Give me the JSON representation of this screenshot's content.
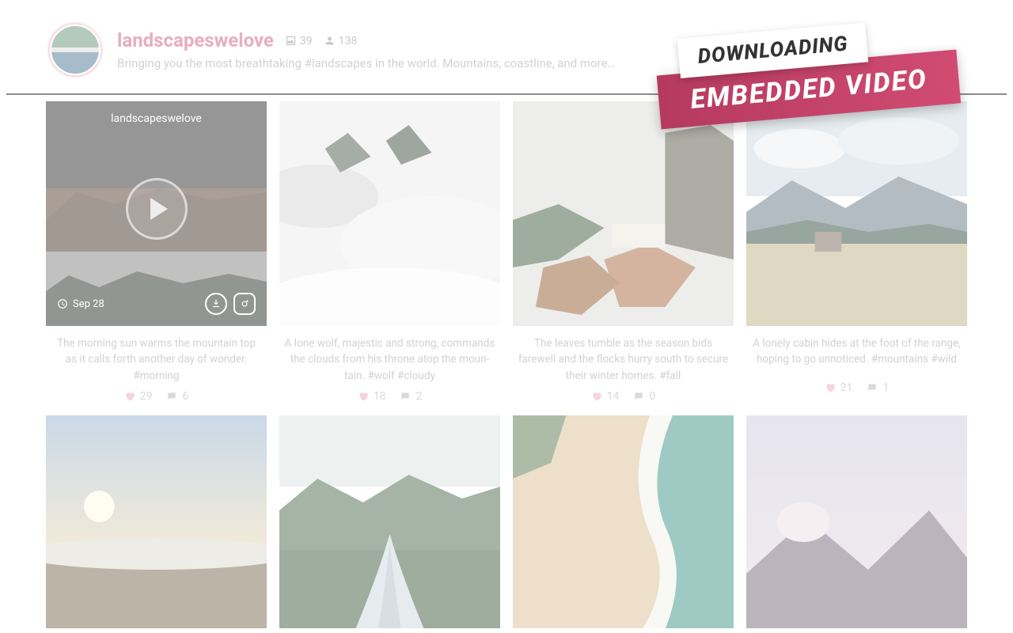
{
  "profile": {
    "username": "landscapeswelove",
    "photo_count": "39",
    "follower_count": "138",
    "bio": "Bringing you the most breathtaking #landscapes in the world. Mountains, coastline, and more…"
  },
  "banner": {
    "top": "DOWNLOADING",
    "bottom": "EMBEDDED VIDEO"
  },
  "posts": [
    {
      "caption": "The morning sun warms the mountain top as it calls forth another day of wonder. #morn­ing",
      "likes": "29",
      "comments": "6",
      "date": "Sep 28",
      "overlay_username": "landscapeswelove",
      "is_video": true
    },
    {
      "caption": "A lone wolf, majestic and strong, commands the clouds from his throne atop the moun­tain. #wolf #cloudy",
      "likes": "18",
      "comments": "2"
    },
    {
      "caption": "The leaves tumble as the season bids farewell and the flocks hurry south to secure their winter homes. #fall",
      "likes": "14",
      "comments": "0"
    },
    {
      "caption": "A lonely cabin hides at the foot of the range, hoping to go unnoticed. #mountains #wild",
      "likes": "21",
      "comments": "1"
    }
  ]
}
